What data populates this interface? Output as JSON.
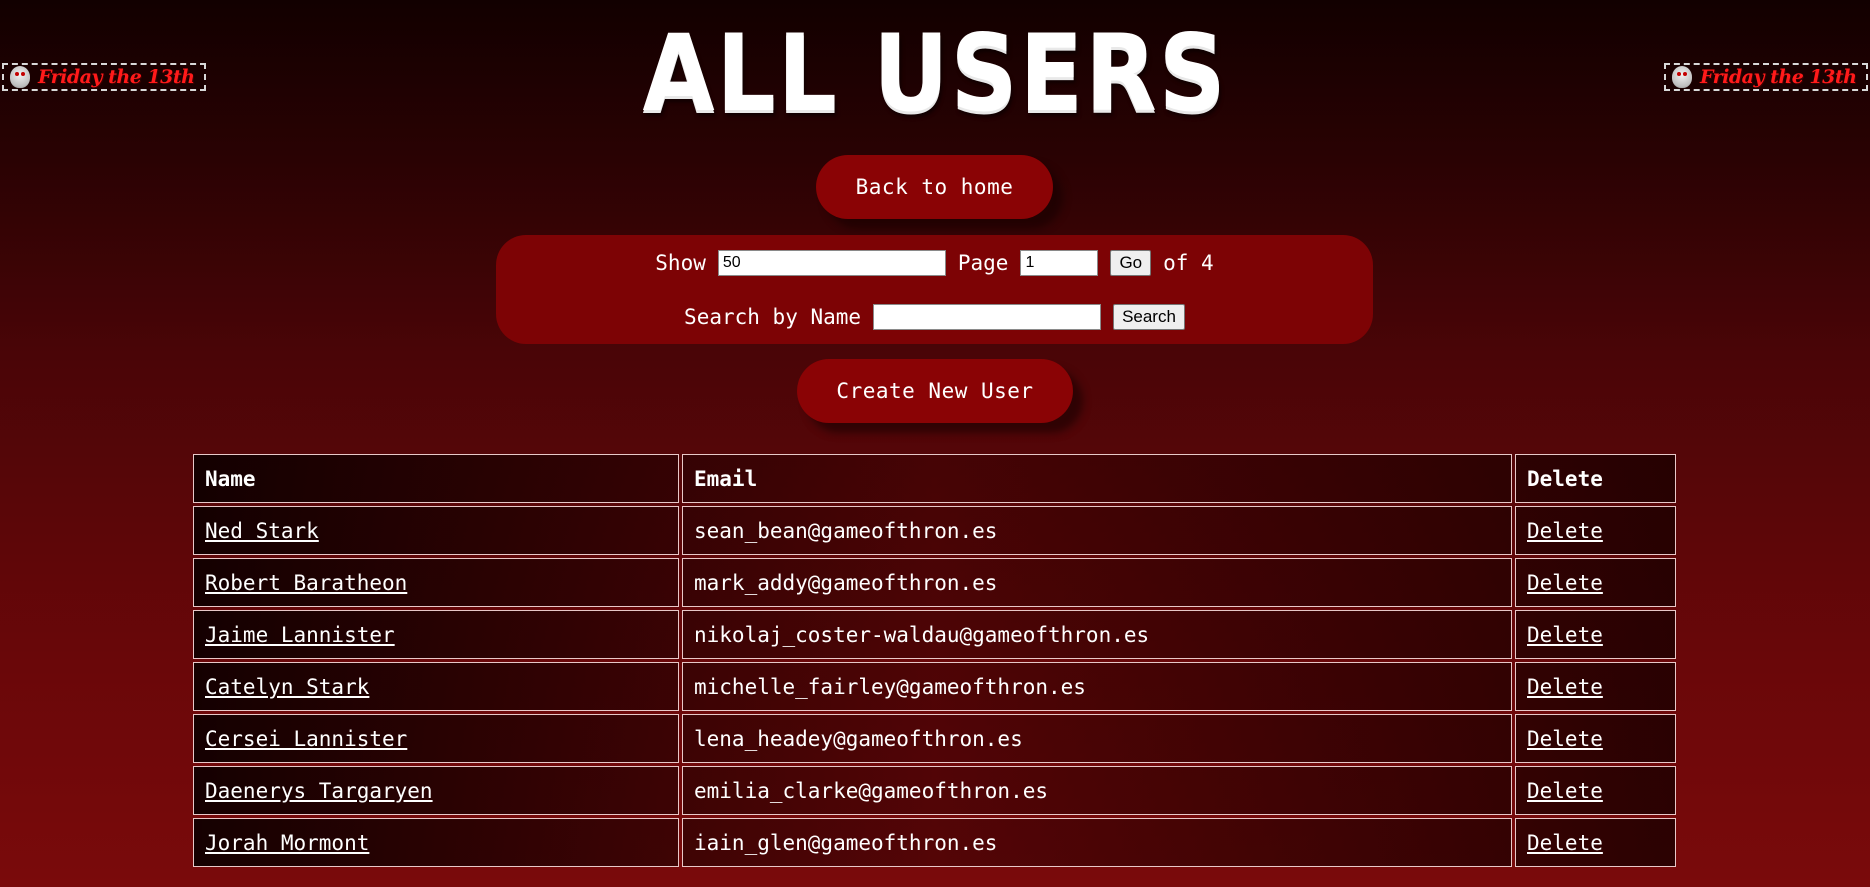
{
  "banner": {
    "text": "Friday the 13th",
    "icon": "hockey-mask-icon",
    "color": "#ff1a1a"
  },
  "page_title": "All Users",
  "back_button": "Back to home",
  "controls": {
    "show_label": "Show",
    "show_value": "50",
    "page_label": "Page",
    "page_value": "1",
    "go_label": "Go",
    "of_label": "of 4",
    "search_label": "Search by Name",
    "search_value": "",
    "search_button": "Search"
  },
  "create_button": "Create New User",
  "table": {
    "headers": [
      "Name",
      "Email",
      "Delete"
    ],
    "rows": [
      {
        "name": "Ned Stark",
        "email": "sean_bean@gameofthron.es",
        "delete": "Delete"
      },
      {
        "name": "Robert Baratheon",
        "email": "mark_addy@gameofthron.es",
        "delete": "Delete"
      },
      {
        "name": "Jaime Lannister",
        "email": "nikolaj_coster-waldau@gameofthron.es",
        "delete": "Delete"
      },
      {
        "name": "Catelyn Stark",
        "email": "michelle_fairley@gameofthron.es",
        "delete": "Delete"
      },
      {
        "name": "Cersei Lannister",
        "email": "lena_headey@gameofthron.es",
        "delete": "Delete"
      },
      {
        "name": "Daenerys Targaryen",
        "email": "emilia_clarke@gameofthron.es",
        "delete": "Delete"
      },
      {
        "name": "Jorah Mormont",
        "email": "iain_glen@gameofthron.es",
        "delete": "Delete"
      }
    ]
  },
  "colors": {
    "accent": "#8a0305",
    "panel": "#7d0305",
    "background_top": "#120000",
    "background_bottom": "#7a0a0b"
  }
}
